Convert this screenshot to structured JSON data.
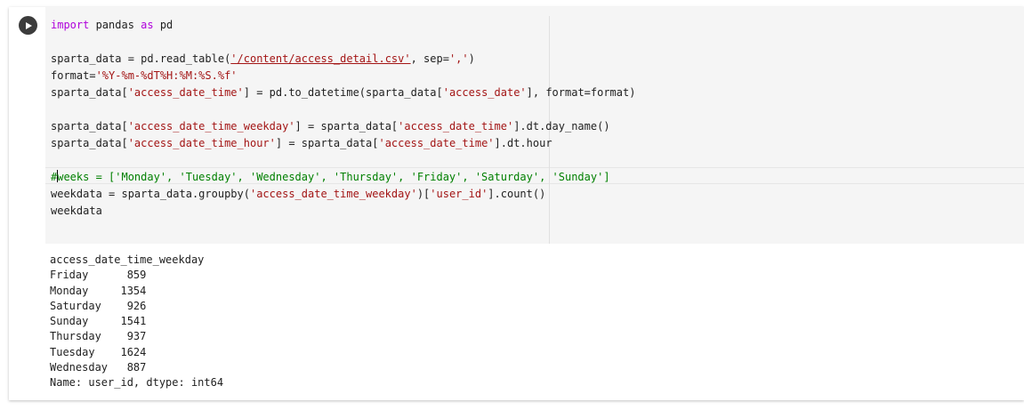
{
  "run_button": {
    "icon": "play-icon"
  },
  "code": {
    "line1": {
      "kw1": "import",
      "mid": " pandas ",
      "kw2": "as",
      "tail": " pd"
    },
    "line3": {
      "pre": "sparta_data = pd.read_table(",
      "path": "'/content/access_detail.csv'",
      "mid": ", sep=",
      "sep": "','",
      "end": ")"
    },
    "line4": {
      "pre": "format=",
      "fmt": "'%Y-%m-%dT%H:%M:%S.%f'"
    },
    "line5": {
      "pre": "sparta_data[",
      "key1": "'access_date_time'",
      "mid1": "] = pd.to_datetime(sparta_data[",
      "key2": "'access_date'",
      "end": "], format=format)"
    },
    "line7": {
      "pre": "sparta_data[",
      "key1": "'access_date_time_weekday'",
      "mid1": "] = sparta_data[",
      "key2": "'access_date_time'",
      "end": "].dt.day_name()"
    },
    "line8": {
      "pre": "sparta_data[",
      "key1": "'access_date_time_hour'",
      "mid1": "] = sparta_data[",
      "key2": "'access_date_time'",
      "end": "].dt.hour"
    },
    "line10": {
      "comment_head": "#",
      "comment_tail": "weeks = ['Monday', 'Tuesday', 'Wednesday', 'Thursday', 'Friday', 'Saturday', 'Sunday']"
    },
    "line11": {
      "pre": "weekdata = sparta_data.groupby(",
      "key1": "'access_date_time_weekday'",
      "mid1": ")[",
      "key2": "'user_id'",
      "end": "].count()"
    },
    "line12": {
      "text": "weekdata"
    }
  },
  "output": {
    "header": "access_date_time_weekday",
    "rows": [
      {
        "day": "Friday",
        "count": "859"
      },
      {
        "day": "Monday",
        "count": "1354"
      },
      {
        "day": "Saturday",
        "count": "926"
      },
      {
        "day": "Sunday",
        "count": "1541"
      },
      {
        "day": "Thursday",
        "count": "937"
      },
      {
        "day": "Tuesday",
        "count": "1624"
      },
      {
        "day": "Wednesday",
        "count": "887"
      }
    ],
    "footer": "Name: user_id, dtype: int64"
  }
}
